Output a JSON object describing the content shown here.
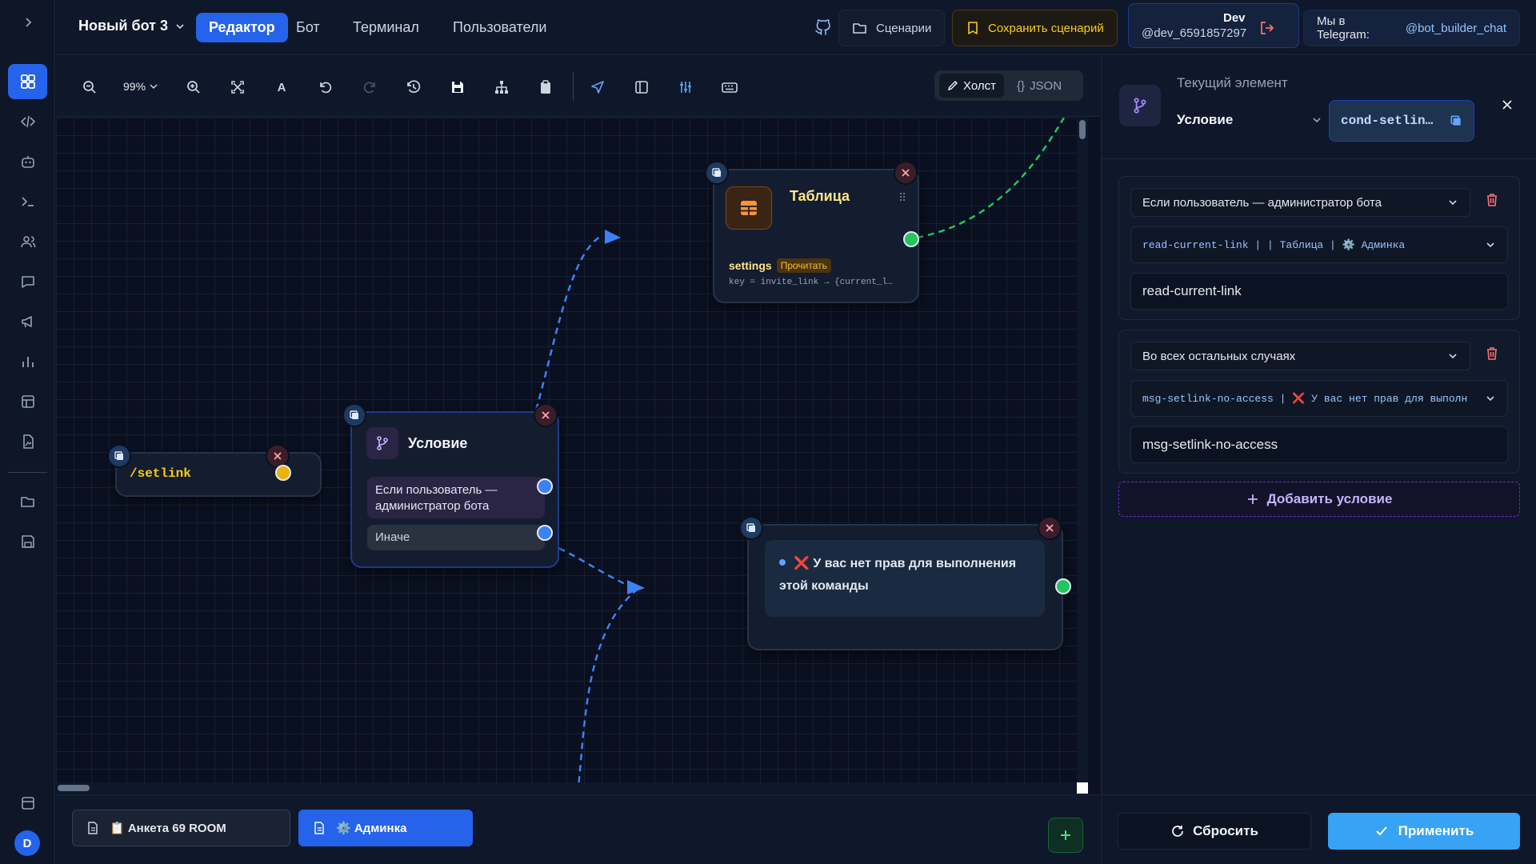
{
  "header": {
    "bot_name": "Новый бот 3",
    "tabs": [
      {
        "label": "Редактор"
      },
      {
        "label": "Бот"
      },
      {
        "label": "Терминал"
      },
      {
        "label": "Пользователи"
      }
    ],
    "scenarios_label": "Сценарии",
    "save_label": "Сохранить сценарий",
    "dev_name": "Dev",
    "dev_user": "@dev_6591857297",
    "telegram_prefix": "Мы в Telegram:",
    "telegram_link": "@bot_builder_chat"
  },
  "toolbar": {
    "zoom": "99%",
    "font_glyph": "A",
    "view_canvas": "Холст",
    "view_json": "JSON",
    "json_glyph": "{}"
  },
  "canvas": {
    "command_node": {
      "text": "/setlink"
    },
    "condition_node": {
      "title": "Условие",
      "branch_1": "Если пользователь — администратор бота",
      "branch_2": "Иначе"
    },
    "table_node": {
      "title": "Таблица",
      "operation": "settings",
      "operation_badge": "Прочитать",
      "code": "key = invite_link → {current_l…"
    },
    "message_node": {
      "text": "У вас нет прав для выполнения этой команды",
      "x_glyph": "❌"
    }
  },
  "bottom_tabs": [
    {
      "label": "📋 Анкета 69 ROOM"
    },
    {
      "label": "⚙️ Админка"
    }
  ],
  "panel": {
    "label": "Текущий элемент",
    "type": "Условие",
    "element_id": "cond-setlin…",
    "conditions": [
      {
        "rule": "Если пользователь — администратор бота",
        "target": "read-current-link | | Таблица | ⚙️ Админка",
        "value": "read-current-link"
      },
      {
        "rule": "Во всех остальных случаях",
        "target": "msg-setlink-no-access | ❌ У вас нет прав для выполн",
        "value": "msg-setlink-no-access"
      }
    ],
    "add_condition": "Добавить условие",
    "reset": "Сбросить",
    "apply": "Применить"
  },
  "user": {
    "avatar_letter": "D"
  },
  "colors": {
    "accent": "#2563eb",
    "apply": "#38a3f5",
    "save": "#facc15",
    "danger": "#ef4444",
    "edge_blue": "#3b82f6",
    "edge_green": "#22c55e"
  }
}
